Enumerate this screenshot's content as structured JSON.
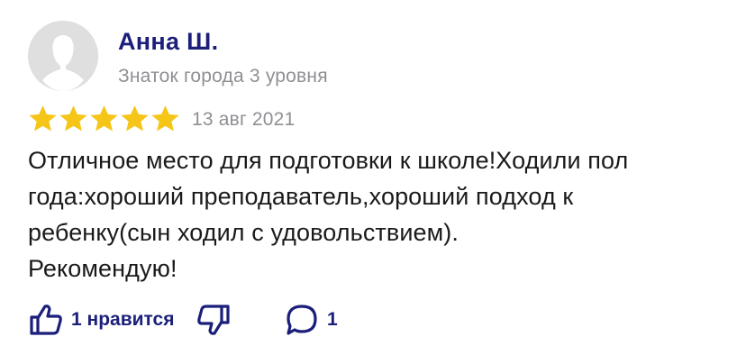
{
  "author": {
    "name": "Анна Ш.",
    "level": "Знаток города 3 уровня"
  },
  "rating": {
    "stars": 5,
    "max": 5,
    "date": "13 авг 2021",
    "star_color": "#f5c518"
  },
  "review": {
    "text": "Отличное место для подготовки к школе!Ходили пол\nгода:хороший преподаватель,хороший подход к\nребенку(сын ходил с удовольствием).\nРекомендую!"
  },
  "actions": {
    "like_label": "1 нравится",
    "like_icon": "thumbs-up-icon",
    "dislike_icon": "thumbs-down-icon",
    "comment_label": "1",
    "comment_icon": "comment-icon",
    "accent_color": "#1b1f7a"
  }
}
